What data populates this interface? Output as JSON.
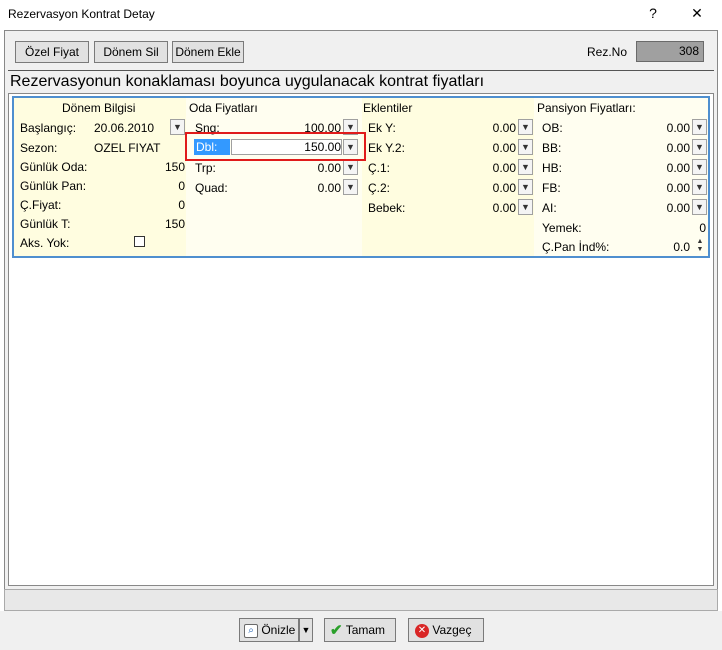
{
  "window": {
    "title": "Rezervasyon Kontrat Detay",
    "help": "?",
    "close": "✕"
  },
  "toolbar": {
    "ozel_fiyat": "Özel Fiyat",
    "donem_sil": "Dönem Sil",
    "donem_ekle": "Dönem Ekle",
    "rez_no_label": "Rez.No",
    "rez_no_value": "308"
  },
  "section_title": "Rezervasyonun konaklaması boyunca uygulanacak kontrat fiyatları",
  "donem": {
    "header": "Dönem Bilgisi",
    "baslangic_label": "Başlangıç:",
    "baslangic_value": "20.06.2010",
    "sezon_label": "Sezon:",
    "sezon_value": "OZEL FIYAT",
    "gunluk_oda_label": "Günlük Oda:",
    "gunluk_oda_value": "150",
    "gunluk_pan_label": "Günlük Pan:",
    "gunluk_pan_value": "0",
    "c_fiyat_label": "Ç.Fiyat:",
    "c_fiyat_value": "0",
    "gunluk_t_label": "Günlük T:",
    "gunluk_t_value": "150",
    "aks_yok_label": "Aks. Yok:"
  },
  "oda": {
    "header": "Oda Fiyatları",
    "sng_label": "Sng:",
    "sng_value": "100.00",
    "dbl_label": "Dbl:",
    "dbl_value": "150.00",
    "trp_label": "Trp:",
    "trp_value": "0.00",
    "quad_label": "Quad:",
    "quad_value": "0.00"
  },
  "eklentiler": {
    "header": "Eklentiler",
    "eky_label": "Ek Y:",
    "eky_value": "0.00",
    "eky2_label": "Ek Y.2:",
    "eky2_value": "0.00",
    "c1_label": "Ç.1:",
    "c1_value": "0.00",
    "c2_label": "Ç.2:",
    "c2_value": "0.00",
    "bebek_label": "Bebek:",
    "bebek_value": "0.00"
  },
  "pansiyon": {
    "header": "Pansiyon Fiyatları:",
    "ob_label": "OB:",
    "ob_value": "0.00",
    "bb_label": "BB:",
    "bb_value": "0.00",
    "hb_label": "HB:",
    "hb_value": "0.00",
    "fb_label": "FB:",
    "fb_value": "0.00",
    "ai_label": "AI:",
    "ai_value": "0.00",
    "yemek_label": "Yemek:",
    "yemek_value": "0",
    "cpan_label": "Ç.Pan İnd%:",
    "cpan_value": "0.0"
  },
  "buttons": {
    "onizle": "Önizle",
    "tamam": "Tamam",
    "vazgec": "Vazgeç"
  },
  "colors": {
    "highlight_border": "#e01b1b",
    "panel_border": "#4f8fcf",
    "selection": "#3399ff"
  }
}
